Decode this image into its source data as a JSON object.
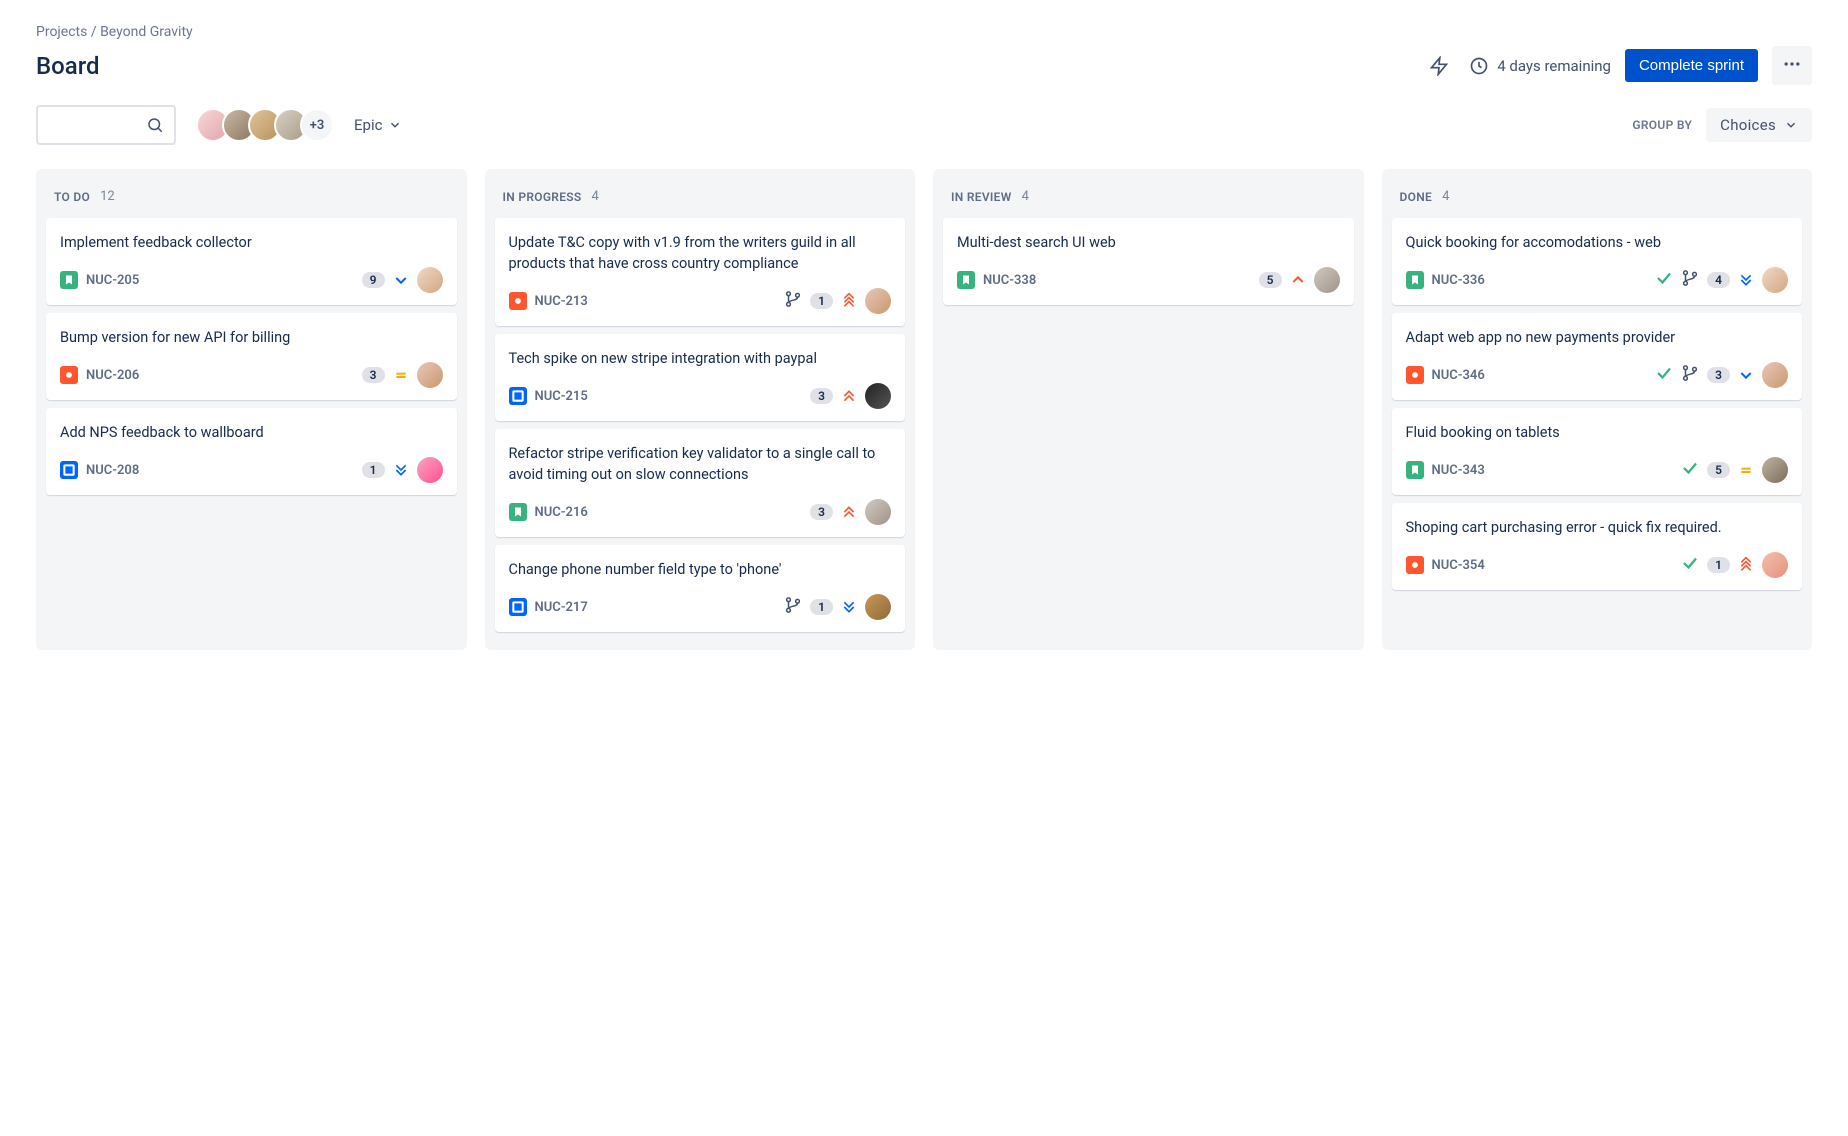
{
  "breadcrumb": {
    "root": "Projects",
    "project": "Beyond Gravity",
    "sep": " / "
  },
  "page_title": "Board",
  "header": {
    "remaining_text": "4 days remaining",
    "complete_sprint_label": "Complete sprint"
  },
  "toolbar": {
    "search_placeholder": "",
    "avatars_overflow": "+3",
    "epic_label": "Epic",
    "group_by_label": "GROUP BY",
    "group_by_value": "Choices"
  },
  "columns": [
    {
      "title": "TO DO",
      "count": "12",
      "cards": [
        {
          "title": "Implement feedback collector",
          "type": "story",
          "key": "NUC-205",
          "done": false,
          "branch": false,
          "badge": "9",
          "priority": "low",
          "assignee_class": "a1"
        },
        {
          "title": "Bump version for new API for billing",
          "type": "bug",
          "key": "NUC-206",
          "done": false,
          "branch": false,
          "badge": "3",
          "priority": "medium",
          "assignee_class": "a2"
        },
        {
          "title": "Add NPS feedback to wallboard",
          "type": "task",
          "key": "NUC-208",
          "done": false,
          "branch": false,
          "badge": "1",
          "priority": "lowest",
          "assignee_class": "a8"
        }
      ]
    },
    {
      "title": "IN PROGRESS",
      "count": "4",
      "cards": [
        {
          "title": "Update T&C copy with v1.9 from the writers guild in all products that have cross country compliance",
          "type": "bug",
          "key": "NUC-213",
          "done": false,
          "branch": true,
          "badge": "1",
          "priority": "highest",
          "assignee_class": "a2"
        },
        {
          "title": "Tech spike on new stripe integration with paypal",
          "type": "task",
          "key": "NUC-215",
          "done": false,
          "branch": false,
          "badge": "3",
          "priority": "high",
          "assignee_class": "a3"
        },
        {
          "title": "Refactor stripe verification key validator to a single call to avoid timing out on slow connections",
          "type": "story",
          "key": "NUC-216",
          "done": false,
          "branch": false,
          "badge": "3",
          "priority": "high",
          "assignee_class": "a5"
        },
        {
          "title": "Change phone number field type to 'phone'",
          "type": "task",
          "key": "NUC-217",
          "done": false,
          "branch": true,
          "badge": "1",
          "priority": "lowest",
          "assignee_class": "a6"
        }
      ]
    },
    {
      "title": "IN REVIEW",
      "count": "4",
      "cards": [
        {
          "title": "Multi-dest search UI web",
          "type": "story",
          "key": "NUC-338",
          "done": false,
          "branch": false,
          "badge": "5",
          "priority": "high-single",
          "assignee_class": "a5"
        }
      ]
    },
    {
      "title": "DONE",
      "count": "4",
      "cards": [
        {
          "title": "Quick booking for accomodations - web",
          "type": "story",
          "key": "NUC-336",
          "done": true,
          "branch": true,
          "badge": "4",
          "priority": "lowest",
          "assignee_class": "a1"
        },
        {
          "title": "Adapt web app no new payments provider",
          "type": "bug",
          "key": "NUC-346",
          "done": true,
          "branch": true,
          "badge": "3",
          "priority": "low",
          "assignee_class": "a2"
        },
        {
          "title": "Fluid booking on tablets",
          "type": "story",
          "key": "NUC-343",
          "done": true,
          "branch": false,
          "badge": "5",
          "priority": "medium",
          "assignee_class": "a7"
        },
        {
          "title": "Shoping cart purchasing error - quick fix required.",
          "type": "bug",
          "key": "NUC-354",
          "done": true,
          "branch": false,
          "badge": "1",
          "priority": "highest",
          "assignee_class": "a4"
        }
      ]
    }
  ]
}
